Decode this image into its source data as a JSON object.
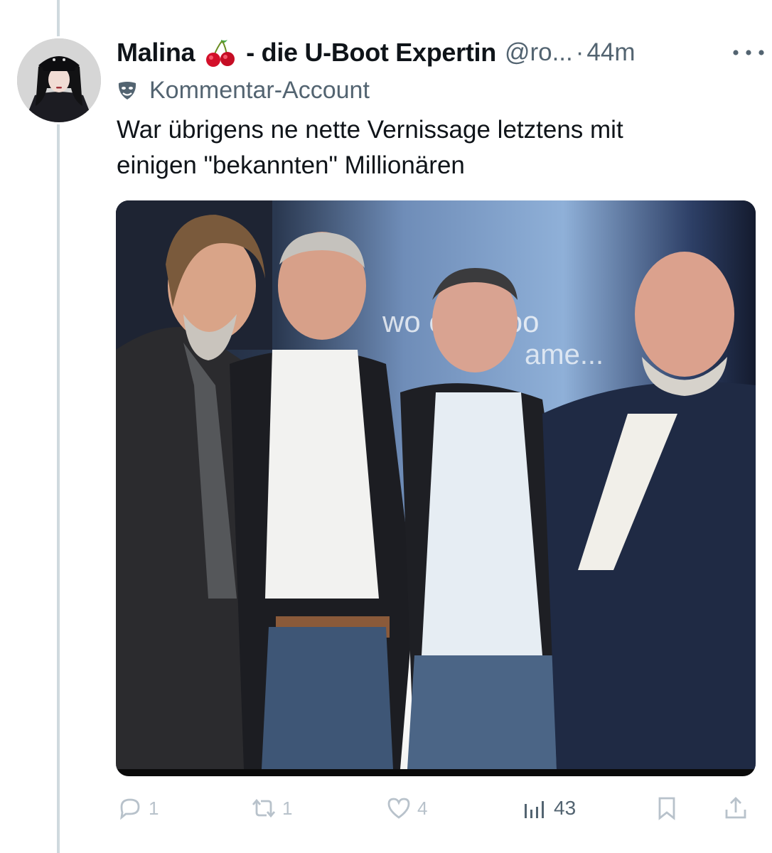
{
  "tweet": {
    "display_name": "Malina",
    "name_suffix": "- die U-Boot Expertin",
    "handle": "@ro...",
    "separator": "·",
    "time": "44m",
    "label": "Kommentar-Account",
    "text_line1": "War übrigens ne nette Vernissage letztens mit",
    "text_line2": "einigen \"bekannten\" Millionären",
    "media_backdrop_line1": "wo        esn't loo",
    "media_backdrop_line2": "ame..."
  },
  "actions": {
    "replies": "1",
    "retweets": "1",
    "likes": "4",
    "views": "43"
  },
  "colors": {
    "text": "#0f1419",
    "secondary": "#536471",
    "muted_icons": "#b8c2cb",
    "thread_line": "#cfd9de"
  },
  "icons": {
    "more": "more-horizontal-icon",
    "cherry": "cherry-icon",
    "label": "theater-mask-icon",
    "reply": "reply-icon",
    "retweet": "retweet-icon",
    "like": "heart-icon",
    "views": "views-bar-chart-icon",
    "bookmark": "bookmark-icon",
    "share": "share-icon"
  }
}
